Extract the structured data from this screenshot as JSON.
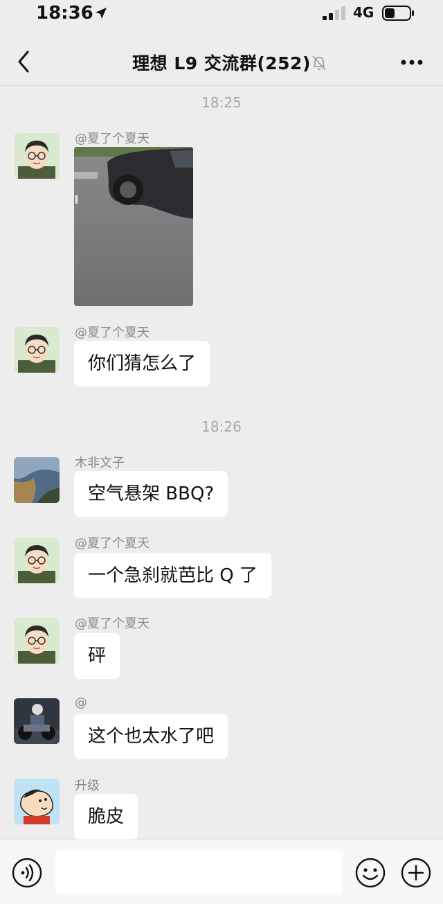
{
  "status_bar": {
    "time": "18:36",
    "network": "4G"
  },
  "header": {
    "title": "理想 L9 交流群(252)"
  },
  "input_bar": {
    "placeholder": ""
  },
  "messages": [
    {
      "type": "timestamp",
      "text": "18:25"
    },
    {
      "type": "image",
      "sender": "@夏了个夏天",
      "avatar": "cartoon-man-glasses"
    },
    {
      "type": "text",
      "sender": "@夏了个夏天",
      "text": "你们猜怎么了",
      "avatar": "cartoon-man-glasses"
    },
    {
      "type": "timestamp",
      "text": "18:26"
    },
    {
      "type": "text",
      "sender": "木非文子",
      "text": "空气悬架 BBQ?",
      "avatar": "landscape-photo"
    },
    {
      "type": "text",
      "sender": "@夏了个夏天",
      "text": "一个急刹就芭比 Q 了",
      "avatar": "cartoon-man-glasses"
    },
    {
      "type": "text",
      "sender": "@夏了个夏天",
      "text": "砰",
      "avatar": "cartoon-man-glasses"
    },
    {
      "type": "text",
      "sender": "@",
      "text": "这个也太水了吧",
      "avatar": "motorcycle-rider"
    },
    {
      "type": "text",
      "sender": "升级",
      "text": "脆皮",
      "avatar": "cartoon-boy"
    }
  ],
  "colors": {
    "background": "#ededed",
    "bubble": "#ffffff",
    "meta_text": "#a6a6a6"
  }
}
